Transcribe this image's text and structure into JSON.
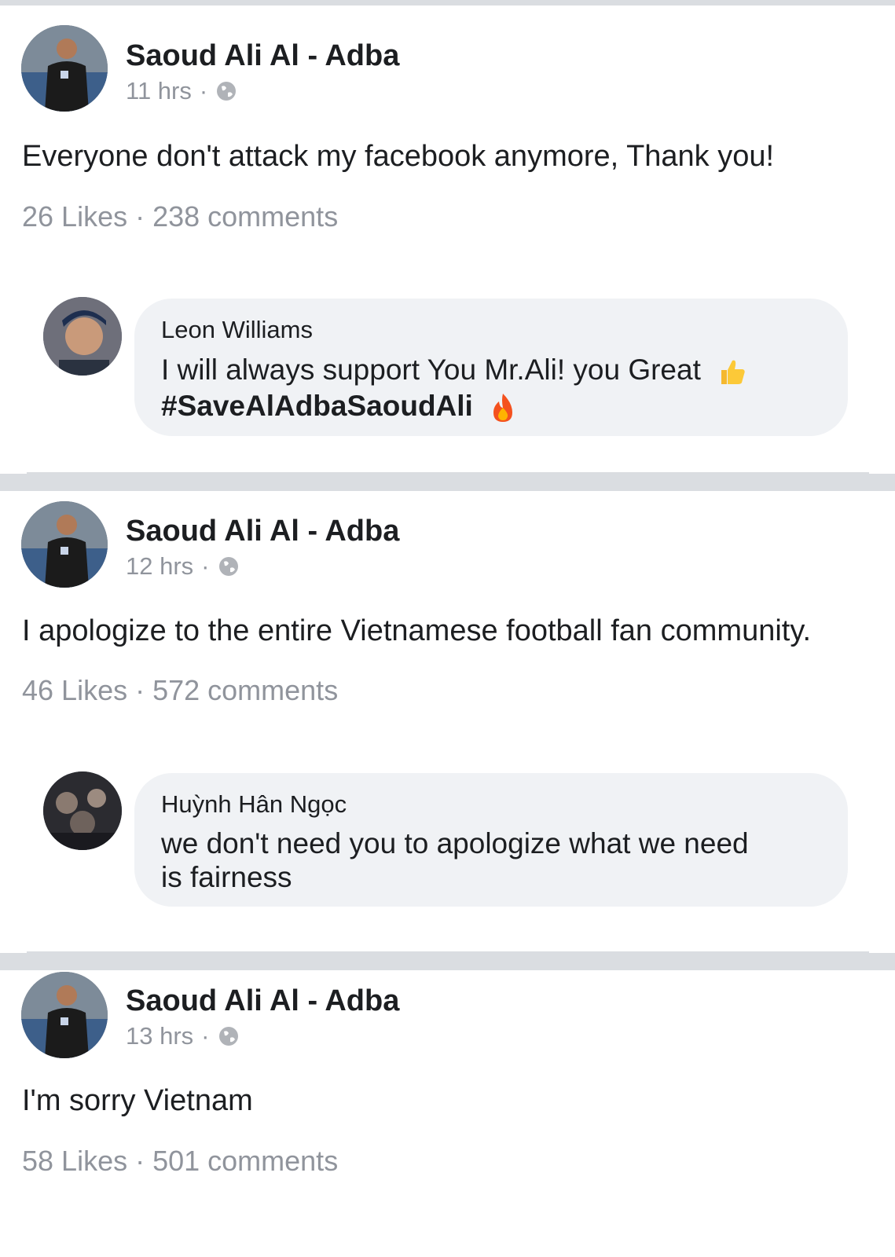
{
  "posts": [
    {
      "author": "Saoud Ali Al - Adba",
      "time": "11 hrs",
      "dot": "·",
      "text": "Everyone don't attack my facebook anymore, Thank you!",
      "stats": "26 Likes · 238 comments",
      "comment": {
        "name": "Leon Williams",
        "text": "I will always support You Mr.Ali! you Great",
        "hashtag": "#SaveAlAdbaSaoudAli"
      }
    },
    {
      "author": "Saoud Ali Al - Adba",
      "time": "12 hrs",
      "dot": "·",
      "text": "I apologize to the entire Vietnamese football fan community.",
      "stats": "46 Likes · 572 comments",
      "comment": {
        "name": "Huỳnh Hân Ngọc",
        "text_line1": "we don't need you to apologize what we need",
        "text_line2": "is fairness"
      }
    },
    {
      "author": "Saoud Ali Al - Adba",
      "time": "13 hrs",
      "dot": "·",
      "text": "I'm sorry Vietnam",
      "stats": "58 Likes · 501 comments"
    }
  ],
  "icons": {
    "globe": "globe-icon",
    "thumbs_up": "thumbs-up-emoji",
    "fire": "fire-emoji"
  },
  "colors": {
    "separator": "#dadde1",
    "meta_text": "#90949c",
    "bubble": "#f0f2f5"
  }
}
